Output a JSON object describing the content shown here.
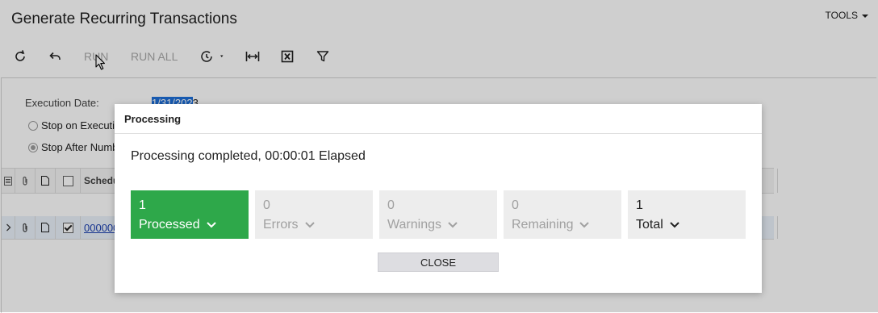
{
  "window": {
    "title": "Generate Recurring Transactions",
    "tools_label": "TOOLS"
  },
  "toolbar": {
    "refresh_icon": "refresh-icon",
    "undo_icon": "undo-icon",
    "run_label": "RUN",
    "run_all_label": "RUN ALL",
    "schedule_icon": "clock-icon",
    "fit_icon": "fit-columns-icon",
    "excel_icon": "excel-export-icon",
    "filter_icon": "filter-icon"
  },
  "form": {
    "execution_date_label": "Execution Date:",
    "execution_date_selected": "1/31/202",
    "execution_date_rest": "3",
    "stop_on_label": "Stop on Executi",
    "stop_after_label": "Stop After Numb"
  },
  "grid": {
    "header_schedule": "Schedu",
    "row_link": "000000"
  },
  "dialog": {
    "title": "Processing",
    "message": "Processing completed, 00:00:01 Elapsed",
    "tiles": [
      {
        "count": "1",
        "label": "Processed"
      },
      {
        "count": "0",
        "label": "Errors"
      },
      {
        "count": "0",
        "label": "Warnings"
      },
      {
        "count": "0",
        "label": "Remaining"
      },
      {
        "count": "1",
        "label": "Total"
      }
    ],
    "close_label": "CLOSE"
  },
  "colors": {
    "processed": "#2ea84a",
    "tile_inactive": "#ededed",
    "selection": "#1e6fd9",
    "link": "#1a3fb0"
  }
}
